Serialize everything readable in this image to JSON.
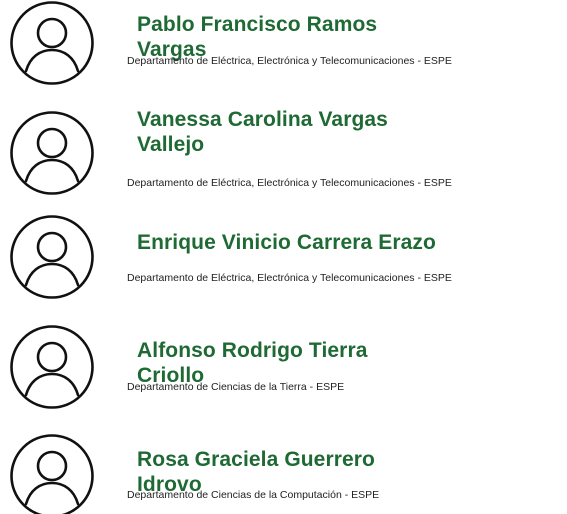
{
  "people": [
    {
      "name": "Pablo Francisco Ramos Vargas",
      "department": "Departamento de Eléctrica, Electrónica y Telecomunicaciones - ESPE",
      "avatar_icon": "user-avatar-icon"
    },
    {
      "name": "Vanessa Carolina Vargas Vallejo",
      "department": "Departamento de Eléctrica, Electrónica y Telecomunicaciones - ESPE",
      "avatar_icon": "user-avatar-icon"
    },
    {
      "name": "Enrique Vinicio Carrera Erazo",
      "department": "Departamento de Eléctrica, Electrónica y Telecomunicaciones - ESPE",
      "avatar_icon": "user-avatar-icon"
    },
    {
      "name": "Alfonso Rodrigo Tierra Criollo",
      "department": "Departamento de Ciencias de la Tierra - ESPE",
      "avatar_icon": "user-avatar-icon"
    },
    {
      "name": "Rosa Graciela Guerrero Idrovo",
      "department": "Departamento de Ciencias de la Computación - ESPE",
      "avatar_icon": "user-avatar-icon"
    }
  ],
  "colors": {
    "name_text": "#1f6a34",
    "department_text": "#222222",
    "avatar_stroke": "#111111"
  }
}
